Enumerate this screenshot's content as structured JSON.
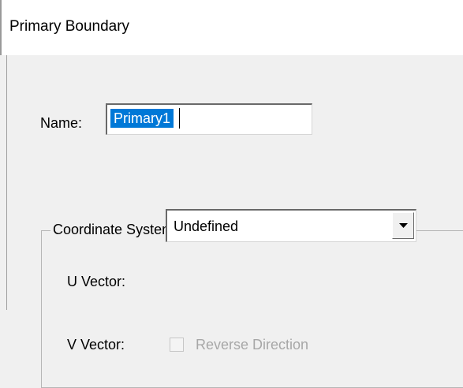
{
  "dialog": {
    "title": "Primary Boundary"
  },
  "name_field": {
    "label": "Name:",
    "value": "Primary1"
  },
  "coordinate_system": {
    "group_label": "Coordinate System",
    "u_vector": {
      "label": "U  Vector:",
      "selected": "Undefined"
    },
    "v_vector": {
      "label": "V  Vector:",
      "reverse_direction": {
        "label": "Reverse Direction",
        "checked": false,
        "enabled": false
      }
    }
  },
  "icons": {
    "dropdown": "chevron-down-icon"
  },
  "colors": {
    "selection_highlight": "#0078d7",
    "disabled_text": "#a7a7a7"
  }
}
